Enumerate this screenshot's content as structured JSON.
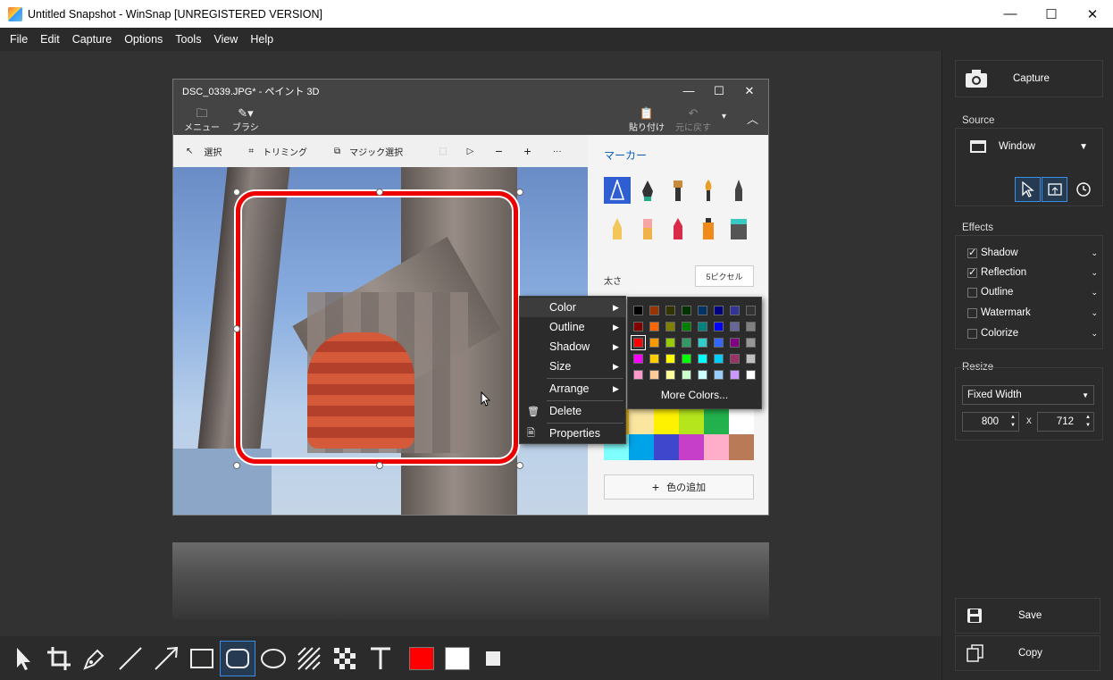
{
  "window": {
    "title": "Untitled Snapshot - WinSnap  [UNREGISTERED VERSION]",
    "min": "—",
    "max": "☐",
    "close": "✕"
  },
  "menu": [
    "File",
    "Edit",
    "Capture",
    "Options",
    "Tools",
    "View",
    "Help"
  ],
  "paint": {
    "title": "DSC_0339.JPG* - ペイント 3D",
    "menu_label": "メニュー",
    "brush_label": "ブラシ",
    "paste_label": "貼り付け",
    "undo_label": "元に戻す",
    "tools": [
      "選択",
      "トリミング",
      "マジック選択"
    ],
    "side_title": "マーカー",
    "thickness_label": "太さ",
    "thickness_value": "5ピクセル",
    "add_color": "色の追加",
    "colors": [
      "#f3c31b",
      "#fbe6a0",
      "#fff200",
      "#b5e61d",
      "#22b14c",
      "#ffffff",
      "#80ffff",
      "#00a2e8",
      "#3f48cc",
      "#c63fc8",
      "#ffaec9",
      "#b97a57"
    ]
  },
  "context_menu": {
    "items": [
      {
        "label": "Color",
        "arrow": "▶"
      },
      {
        "label": "Outline",
        "arrow": "▶"
      },
      {
        "label": "Shadow",
        "arrow": "▶"
      },
      {
        "label": "Size",
        "arrow": "▶"
      },
      {
        "label": "Arrange",
        "arrow": "▶"
      },
      {
        "label": "Delete",
        "arrow": ""
      },
      {
        "label": "Properties",
        "arrow": ""
      }
    ],
    "more_colors": "More Colors...",
    "palette": [
      [
        "#000000",
        "#993300",
        "#333300",
        "#003300",
        "#003366",
        "#000080",
        "#333399",
        "#333333"
      ],
      [
        "#800000",
        "#ff6600",
        "#808000",
        "#008000",
        "#008080",
        "#0000ff",
        "#666699",
        "#808080"
      ],
      [
        "#ff0000",
        "#ff9900",
        "#99cc00",
        "#339966",
        "#33cccc",
        "#3366ff",
        "#800080",
        "#969696"
      ],
      [
        "#ff00ff",
        "#ffcc00",
        "#ffff00",
        "#00ff00",
        "#00ffff",
        "#00ccff",
        "#993366",
        "#c0c0c0"
      ],
      [
        "#ff99cc",
        "#ffcc99",
        "#ffff99",
        "#ccffcc",
        "#ccffff",
        "#99ccff",
        "#cc99ff",
        "#ffffff"
      ]
    ]
  },
  "right": {
    "capture": "Capture",
    "source_title": "Source",
    "source_value": "Window",
    "effects_title": "Effects",
    "effects": [
      {
        "label": "Shadow",
        "checked": true
      },
      {
        "label": "Reflection",
        "checked": true
      },
      {
        "label": "Outline",
        "checked": false
      },
      {
        "label": "Watermark",
        "checked": false
      },
      {
        "label": "Colorize",
        "checked": false
      }
    ],
    "resize_title": "Resize",
    "resize_mode": "Fixed Width",
    "width": "800",
    "height": "712",
    "x_label": "x",
    "save": "Save",
    "copy": "Copy"
  },
  "tools": [
    "pointer",
    "crop",
    "pen",
    "line",
    "arrow",
    "rectangle",
    "rounded-rectangle",
    "ellipse",
    "hatch",
    "pixelate",
    "text"
  ],
  "fg_color": "#ff0000",
  "bg_color": "#ffffff"
}
